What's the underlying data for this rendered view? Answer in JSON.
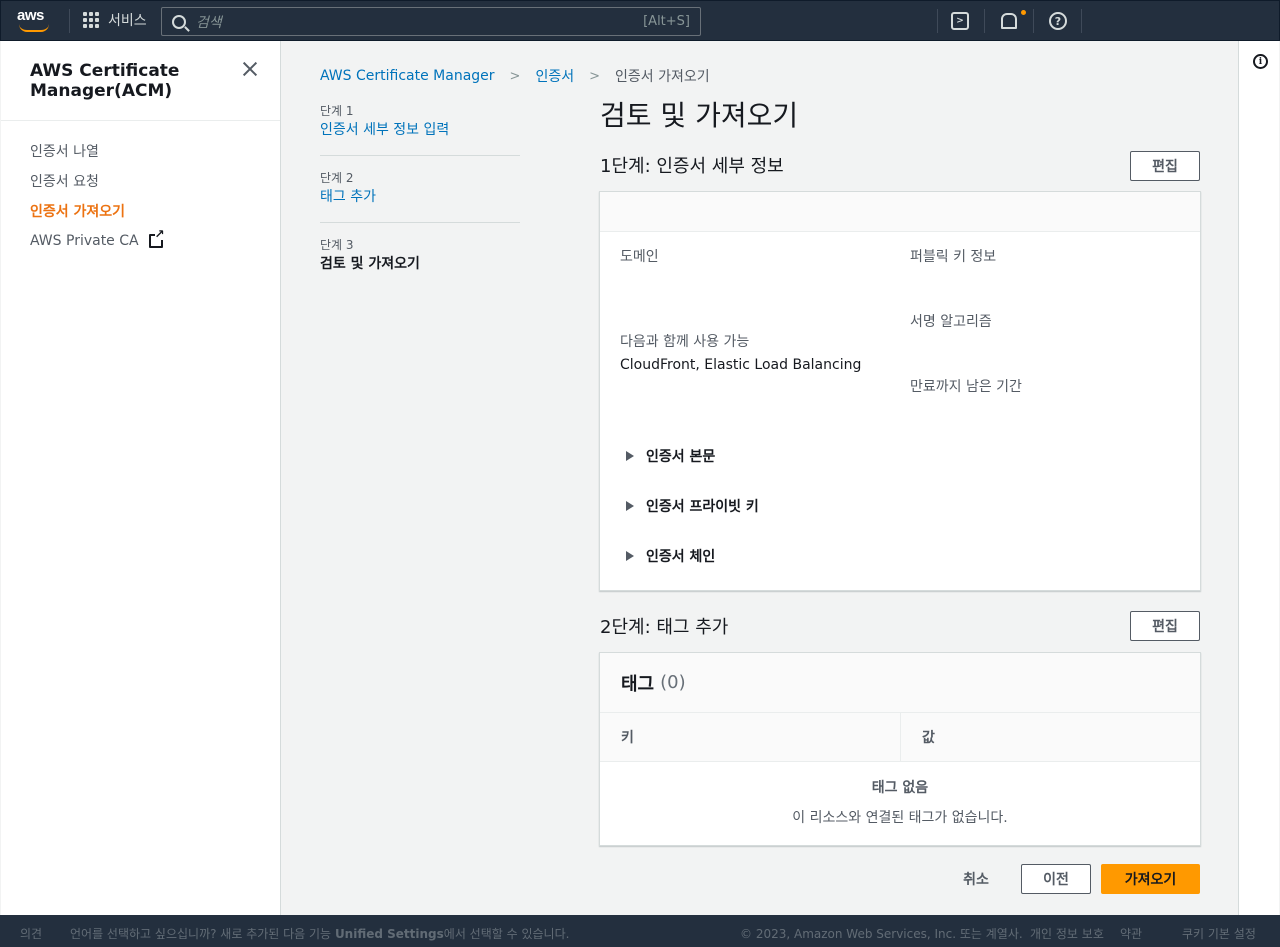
{
  "topnav": {
    "logo_text": "aws",
    "services_label": "서비스",
    "search_placeholder": "검색",
    "search_shortcut": "[Alt+S]"
  },
  "sidenav": {
    "title": "AWS Certificate Manager(ACM)",
    "items": [
      {
        "label": "인증서 나열"
      },
      {
        "label": "인증서 요청"
      },
      {
        "label": "인증서 가져오기"
      },
      {
        "label": "AWS Private CA"
      }
    ]
  },
  "breadcrumb": {
    "items": [
      "AWS Certificate Manager",
      "인증서",
      "인증서 가져오기"
    ]
  },
  "wizard": {
    "steps": [
      {
        "num": "단계 1",
        "label": "인증서 세부 정보 입력"
      },
      {
        "num": "단계 2",
        "label": "태그 추가"
      },
      {
        "num": "단계 3",
        "label": "검토 및 가져오기"
      }
    ]
  },
  "main": {
    "page_title": "검토 및 가져오기",
    "section1": {
      "title": "1단계: 인증서 세부 정보",
      "edit_label": "편집",
      "domain_label": "도메인",
      "public_key_label": "퍼블릭 키 정보",
      "usable_with_label": "다음과 함께 사용 가능",
      "usable_with_value": "CloudFront, Elastic Load Balancing",
      "signature_label": "서명 알고리즘",
      "expiry_label": "만료까지 남은 기간",
      "expanders": [
        "인증서 본문",
        "인증서 프라이빗 키",
        "인증서 체인"
      ]
    },
    "section2": {
      "title": "2단계: 태그 추가",
      "edit_label": "편집",
      "table_title": "태그",
      "table_count": "(0)",
      "col_key": "키",
      "col_value": "값",
      "empty_title": "태그 없음",
      "empty_desc": "이 리소스와 연결된 태그가 없습니다."
    },
    "actions": {
      "cancel": "취소",
      "previous": "이전",
      "import": "가져오기"
    }
  },
  "footer": {
    "feedback": "의견",
    "lang_prompt": "언어를 선택하고 싶으십니까? 새로 추가된 다음 기능",
    "unified_settings": "Unified Settings",
    "lang_suffix": "에서 선택할 수 있습니다.",
    "copyright": "© 2023, Amazon Web Services, Inc. 또는 계열사.",
    "privacy": "개인 정보 보호",
    "terms": "약관",
    "cookies": "쿠키 기본 설정"
  },
  "colors": {
    "nav_bg": "#232f3e",
    "accent_orange": "#ff9900",
    "active_nav": "#ec7211",
    "link_blue": "#0073bb"
  }
}
